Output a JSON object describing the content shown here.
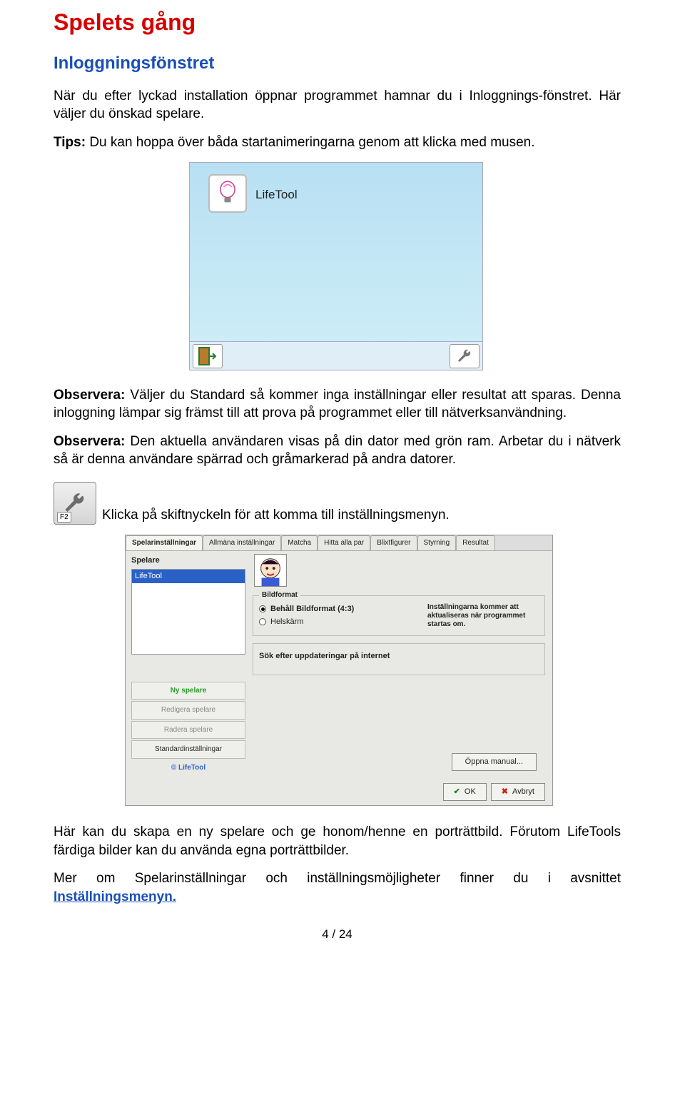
{
  "doc": {
    "h1": "Spelets gång",
    "h2": "Inloggningsfönstret",
    "p1": "När du efter lyckad installation öppnar programmet hamnar du i Inloggnings-fönstret. Här väljer du önskad spelare.",
    "p2_bold": "Tips:",
    "p2_text": " Du kan hoppa över båda startanimeringarna genom att klicka med musen.",
    "p3a_bold": "Observera:",
    "p3a": " Väljer du Standard så kommer inga inställningar eller resultat att sparas. Denna inloggning lämpar sig främst till att prova på programmet eller till nätverksanvändning.",
    "p3b_bold": "Observera:",
    "p3b": " Den aktuella användaren visas på din dator med grön ram. Arbetar du i nätverk så är denna användare spärrad och gråmarkerad på andra datorer.",
    "wrench_caption": "Klicka på skiftnyckeln för att komma till inställningsmenyn.",
    "wrench_keycap": "F2",
    "p4": "Här kan du skapa en ny spelare och ge honom/henne en porträttbild. Förutom LifeTools färdiga bilder kan du använda egna porträttbilder.",
    "p5_a": "Mer om Spelarinställningar och inställningsmöjligheter finner du i avsnittet ",
    "p5_link": "Inställningsmenyn.",
    "page_num": "4 / 24"
  },
  "login": {
    "tile_label": "LifeTool"
  },
  "settings": {
    "tabs": [
      "Spelarinställningar",
      "Allmäna inställningar",
      "Matcha",
      "Hitta alla par",
      "Blixtfigurer",
      "Styrning",
      "Resultat"
    ],
    "active_tab": 0,
    "spelare_label": "Spelare",
    "player_item": "LifeTool",
    "btn_new": "Ny spelare",
    "btn_edit": "Redigera spelare",
    "btn_del": "Radera spelare",
    "btn_std": "Standardinställningar",
    "brand": "© LifeTool",
    "group_bild": "Bildformat",
    "radio_keep": "Behåll Bildformat (4:3)",
    "radio_full": "Helskärm",
    "hint": "Inställningarna kommer att aktualiseras när programmet startas om.",
    "group_update": "Sök efter uppdateringar på internet",
    "manual_btn": "Öppna manual...",
    "ok": "OK",
    "cancel": "Avbryt"
  }
}
